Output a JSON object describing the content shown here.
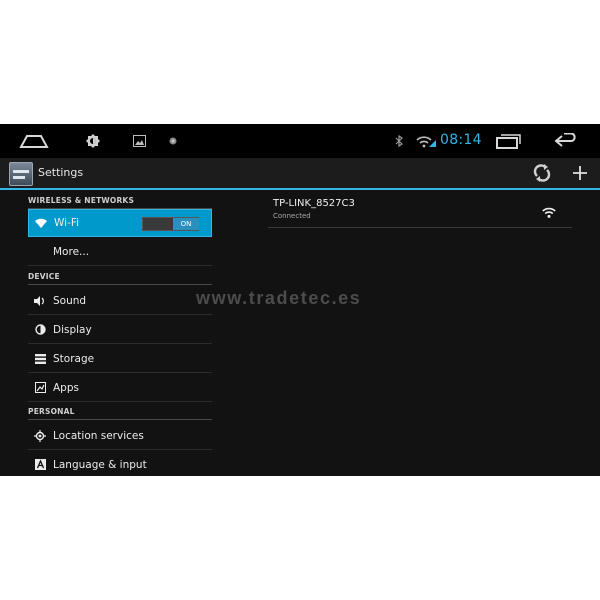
{
  "system_bar": {
    "clock": "08:14",
    "icons": [
      "home-icon",
      "brightness-icon",
      "gallery-icon",
      "notification-dot-icon",
      "bluetooth-icon",
      "wifi-status-icon",
      "recent-apps-icon",
      "back-icon"
    ],
    "clock_color": "#33b5e5"
  },
  "action_bar": {
    "title": "Settings",
    "icons": [
      "settings-app-icon",
      "refresh-icon",
      "add-icon"
    ]
  },
  "sections": {
    "wireless": {
      "header": "WIRELESS & NETWORKS",
      "wifi_label": "Wi-Fi",
      "wifi_toggle": "ON",
      "more_label": "More..."
    },
    "device": {
      "header": "DEVICE",
      "sound": "Sound",
      "display": "Display",
      "storage": "Storage",
      "apps": "Apps"
    },
    "personal": {
      "header": "PERSONAL",
      "location": "Location services",
      "language": "Language & input"
    }
  },
  "network": {
    "ssid": "TP-LINK_8527C3",
    "status": "Connected",
    "signal_icon": "wifi-signal-icon"
  },
  "watermark": "www.tradetec.es",
  "colors": {
    "accent": "#33b5e5",
    "selected_bg": "#0099cc",
    "background": "#121212"
  }
}
